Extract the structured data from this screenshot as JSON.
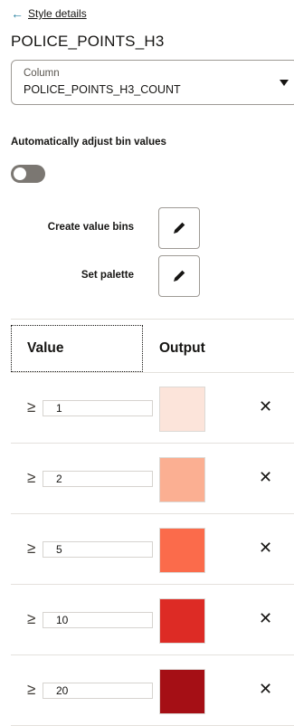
{
  "header": {
    "back_label": "Style details",
    "layer_title": "POLICE_POINTS_H3"
  },
  "column_select": {
    "caption": "Column",
    "value": "POLICE_POINTS_H3_COUNT"
  },
  "auto_adjust": {
    "label": "Automatically adjust bin values",
    "enabled": false
  },
  "actions": {
    "create_bins_label": "Create value bins",
    "set_palette_label": "Set palette"
  },
  "table": {
    "value_header": "Value",
    "output_header": "Output",
    "comparator": "≥",
    "rows": [
      {
        "value": "1",
        "color": "#fce4da"
      },
      {
        "value": "2",
        "color": "#fbaf92"
      },
      {
        "value": "5",
        "color": "#fb6b4b"
      },
      {
        "value": "10",
        "color": "#dd2b25"
      },
      {
        "value": "20",
        "color": "#a50f15"
      }
    ]
  },
  "colors": {
    "accent": "#227e9e",
    "toggle_off": "#7b7772"
  }
}
